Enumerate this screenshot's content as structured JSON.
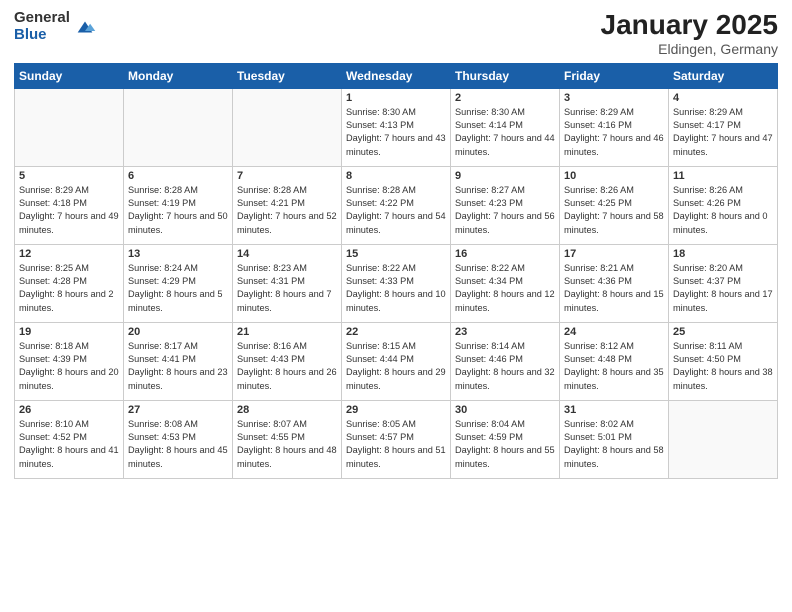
{
  "logo": {
    "general": "General",
    "blue": "Blue"
  },
  "title": "January 2025",
  "subtitle": "Eldingen, Germany",
  "weekdays": [
    "Sunday",
    "Monday",
    "Tuesday",
    "Wednesday",
    "Thursday",
    "Friday",
    "Saturday"
  ],
  "weeks": [
    [
      {
        "num": "",
        "sunrise": "",
        "sunset": "",
        "daylight": "",
        "empty": true
      },
      {
        "num": "",
        "sunrise": "",
        "sunset": "",
        "daylight": "",
        "empty": true
      },
      {
        "num": "",
        "sunrise": "",
        "sunset": "",
        "daylight": "",
        "empty": true
      },
      {
        "num": "1",
        "sunrise": "Sunrise: 8:30 AM",
        "sunset": "Sunset: 4:13 PM",
        "daylight": "Daylight: 7 hours and 43 minutes."
      },
      {
        "num": "2",
        "sunrise": "Sunrise: 8:30 AM",
        "sunset": "Sunset: 4:14 PM",
        "daylight": "Daylight: 7 hours and 44 minutes."
      },
      {
        "num": "3",
        "sunrise": "Sunrise: 8:29 AM",
        "sunset": "Sunset: 4:16 PM",
        "daylight": "Daylight: 7 hours and 46 minutes."
      },
      {
        "num": "4",
        "sunrise": "Sunrise: 8:29 AM",
        "sunset": "Sunset: 4:17 PM",
        "daylight": "Daylight: 7 hours and 47 minutes."
      }
    ],
    [
      {
        "num": "5",
        "sunrise": "Sunrise: 8:29 AM",
        "sunset": "Sunset: 4:18 PM",
        "daylight": "Daylight: 7 hours and 49 minutes."
      },
      {
        "num": "6",
        "sunrise": "Sunrise: 8:28 AM",
        "sunset": "Sunset: 4:19 PM",
        "daylight": "Daylight: 7 hours and 50 minutes."
      },
      {
        "num": "7",
        "sunrise": "Sunrise: 8:28 AM",
        "sunset": "Sunset: 4:21 PM",
        "daylight": "Daylight: 7 hours and 52 minutes."
      },
      {
        "num": "8",
        "sunrise": "Sunrise: 8:28 AM",
        "sunset": "Sunset: 4:22 PM",
        "daylight": "Daylight: 7 hours and 54 minutes."
      },
      {
        "num": "9",
        "sunrise": "Sunrise: 8:27 AM",
        "sunset": "Sunset: 4:23 PM",
        "daylight": "Daylight: 7 hours and 56 minutes."
      },
      {
        "num": "10",
        "sunrise": "Sunrise: 8:26 AM",
        "sunset": "Sunset: 4:25 PM",
        "daylight": "Daylight: 7 hours and 58 minutes."
      },
      {
        "num": "11",
        "sunrise": "Sunrise: 8:26 AM",
        "sunset": "Sunset: 4:26 PM",
        "daylight": "Daylight: 8 hours and 0 minutes."
      }
    ],
    [
      {
        "num": "12",
        "sunrise": "Sunrise: 8:25 AM",
        "sunset": "Sunset: 4:28 PM",
        "daylight": "Daylight: 8 hours and 2 minutes."
      },
      {
        "num": "13",
        "sunrise": "Sunrise: 8:24 AM",
        "sunset": "Sunset: 4:29 PM",
        "daylight": "Daylight: 8 hours and 5 minutes."
      },
      {
        "num": "14",
        "sunrise": "Sunrise: 8:23 AM",
        "sunset": "Sunset: 4:31 PM",
        "daylight": "Daylight: 8 hours and 7 minutes."
      },
      {
        "num": "15",
        "sunrise": "Sunrise: 8:22 AM",
        "sunset": "Sunset: 4:33 PM",
        "daylight": "Daylight: 8 hours and 10 minutes."
      },
      {
        "num": "16",
        "sunrise": "Sunrise: 8:22 AM",
        "sunset": "Sunset: 4:34 PM",
        "daylight": "Daylight: 8 hours and 12 minutes."
      },
      {
        "num": "17",
        "sunrise": "Sunrise: 8:21 AM",
        "sunset": "Sunset: 4:36 PM",
        "daylight": "Daylight: 8 hours and 15 minutes."
      },
      {
        "num": "18",
        "sunrise": "Sunrise: 8:20 AM",
        "sunset": "Sunset: 4:37 PM",
        "daylight": "Daylight: 8 hours and 17 minutes."
      }
    ],
    [
      {
        "num": "19",
        "sunrise": "Sunrise: 8:18 AM",
        "sunset": "Sunset: 4:39 PM",
        "daylight": "Daylight: 8 hours and 20 minutes."
      },
      {
        "num": "20",
        "sunrise": "Sunrise: 8:17 AM",
        "sunset": "Sunset: 4:41 PM",
        "daylight": "Daylight: 8 hours and 23 minutes."
      },
      {
        "num": "21",
        "sunrise": "Sunrise: 8:16 AM",
        "sunset": "Sunset: 4:43 PM",
        "daylight": "Daylight: 8 hours and 26 minutes."
      },
      {
        "num": "22",
        "sunrise": "Sunrise: 8:15 AM",
        "sunset": "Sunset: 4:44 PM",
        "daylight": "Daylight: 8 hours and 29 minutes."
      },
      {
        "num": "23",
        "sunrise": "Sunrise: 8:14 AM",
        "sunset": "Sunset: 4:46 PM",
        "daylight": "Daylight: 8 hours and 32 minutes."
      },
      {
        "num": "24",
        "sunrise": "Sunrise: 8:12 AM",
        "sunset": "Sunset: 4:48 PM",
        "daylight": "Daylight: 8 hours and 35 minutes."
      },
      {
        "num": "25",
        "sunrise": "Sunrise: 8:11 AM",
        "sunset": "Sunset: 4:50 PM",
        "daylight": "Daylight: 8 hours and 38 minutes."
      }
    ],
    [
      {
        "num": "26",
        "sunrise": "Sunrise: 8:10 AM",
        "sunset": "Sunset: 4:52 PM",
        "daylight": "Daylight: 8 hours and 41 minutes."
      },
      {
        "num": "27",
        "sunrise": "Sunrise: 8:08 AM",
        "sunset": "Sunset: 4:53 PM",
        "daylight": "Daylight: 8 hours and 45 minutes."
      },
      {
        "num": "28",
        "sunrise": "Sunrise: 8:07 AM",
        "sunset": "Sunset: 4:55 PM",
        "daylight": "Daylight: 8 hours and 48 minutes."
      },
      {
        "num": "29",
        "sunrise": "Sunrise: 8:05 AM",
        "sunset": "Sunset: 4:57 PM",
        "daylight": "Daylight: 8 hours and 51 minutes."
      },
      {
        "num": "30",
        "sunrise": "Sunrise: 8:04 AM",
        "sunset": "Sunset: 4:59 PM",
        "daylight": "Daylight: 8 hours and 55 minutes."
      },
      {
        "num": "31",
        "sunrise": "Sunrise: 8:02 AM",
        "sunset": "Sunset: 5:01 PM",
        "daylight": "Daylight: 8 hours and 58 minutes."
      },
      {
        "num": "",
        "sunrise": "",
        "sunset": "",
        "daylight": "",
        "empty": true
      }
    ]
  ]
}
